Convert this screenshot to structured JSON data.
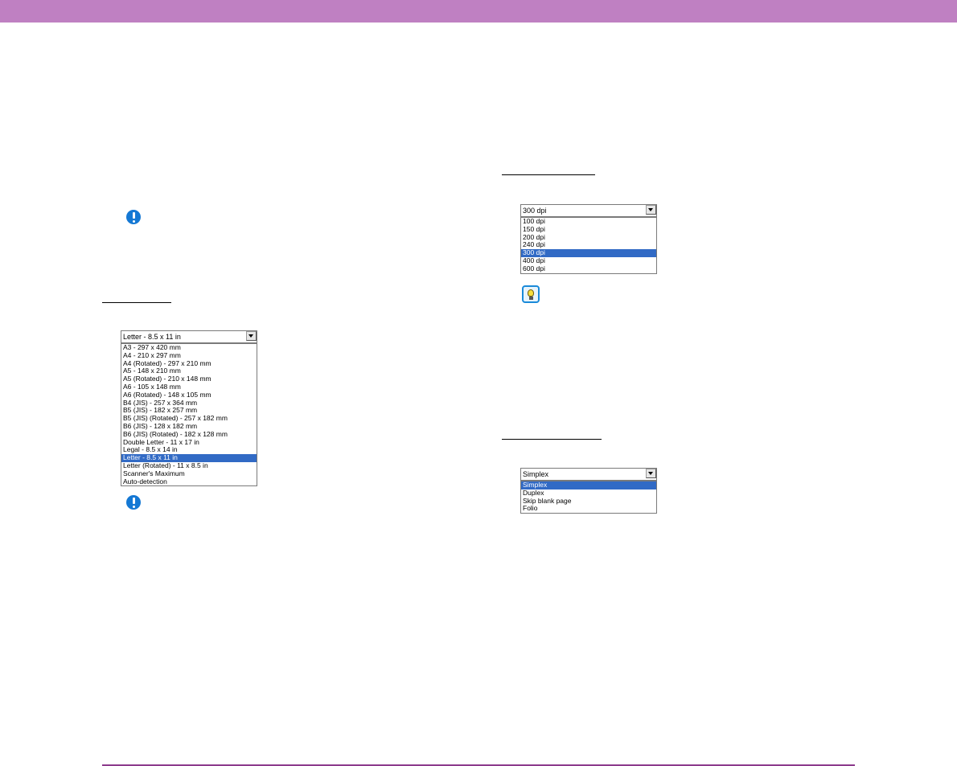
{
  "paper_size": {
    "selected": "Letter - 8.5 x 11 in",
    "options": [
      {
        "label": "A3 - 297 x 420 mm",
        "selected": false
      },
      {
        "label": "A4 - 210 x 297 mm",
        "selected": false
      },
      {
        "label": "A4 (Rotated) - 297 x 210 mm",
        "selected": false
      },
      {
        "label": "A5 - 148 x 210 mm",
        "selected": false
      },
      {
        "label": "A5 (Rotated) - 210 x 148 mm",
        "selected": false
      },
      {
        "label": "A6 - 105 x 148 mm",
        "selected": false
      },
      {
        "label": "A6 (Rotated) - 148 x 105 mm",
        "selected": false
      },
      {
        "label": "B4 (JIS) - 257 x 364 mm",
        "selected": false
      },
      {
        "label": "B5 (JIS) - 182 x 257 mm",
        "selected": false
      },
      {
        "label": "B5 (JIS) (Rotated) - 257 x 182 mm",
        "selected": false
      },
      {
        "label": "B6 (JIS) - 128 x 182 mm",
        "selected": false
      },
      {
        "label": "B6 (JIS) (Rotated) - 182 x 128 mm",
        "selected": false
      },
      {
        "label": "Double Letter - 11 x 17 in",
        "selected": false
      },
      {
        "label": "Legal - 8.5 x 14 in",
        "selected": false
      },
      {
        "label": "Letter - 8.5 x 11 in",
        "selected": true
      },
      {
        "label": "Letter (Rotated) - 11 x 8.5 in",
        "selected": false
      },
      {
        "label": "Scanner's Maximum",
        "selected": false
      },
      {
        "label": "Auto-detection",
        "selected": false
      }
    ]
  },
  "resolution": {
    "selected": "300 dpi",
    "options": [
      {
        "label": "100 dpi",
        "selected": false
      },
      {
        "label": "150 dpi",
        "selected": false
      },
      {
        "label": "200 dpi",
        "selected": false
      },
      {
        "label": "240 dpi",
        "selected": false
      },
      {
        "label": "300 dpi",
        "selected": true
      },
      {
        "label": "400 dpi",
        "selected": false
      },
      {
        "label": "600 dpi",
        "selected": false
      }
    ]
  },
  "scanning_side": {
    "selected": "Simplex",
    "options": [
      {
        "label": "Simplex",
        "selected": true
      },
      {
        "label": "Duplex",
        "selected": false
      },
      {
        "label": "Skip blank page",
        "selected": false
      },
      {
        "label": "Folio",
        "selected": false
      }
    ]
  },
  "icons": {
    "important": "important-icon",
    "hint": "hint-lightbulb-icon",
    "dropdown": "chevron-down-icon"
  },
  "colors": {
    "header_bar": "#bf80c2",
    "footer_rule": "#8c3a8c",
    "selection": "#316ac5",
    "important_icon": "#1478d4"
  }
}
